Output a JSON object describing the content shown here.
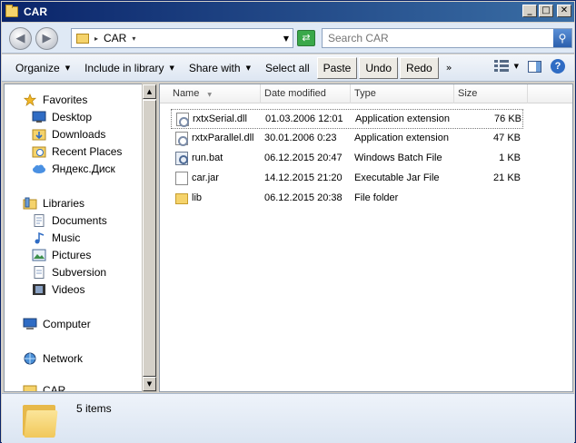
{
  "window": {
    "title": "CAR"
  },
  "address": {
    "path": "CAR",
    "search_placeholder": "Search CAR"
  },
  "toolbar": {
    "organize": "Organize",
    "include_in_library": "Include in library",
    "share_with": "Share with",
    "select_all": "Select all",
    "paste": "Paste",
    "undo": "Undo",
    "redo": "Redo",
    "more": "»"
  },
  "nav": {
    "favorites": "Favorites",
    "desktop": "Desktop",
    "downloads": "Downloads",
    "recent_places": "Recent Places",
    "yandex_disk": "Яндекс.Диск",
    "libraries": "Libraries",
    "documents": "Documents",
    "music": "Music",
    "pictures": "Pictures",
    "subversion": "Subversion",
    "videos": "Videos",
    "computer": "Computer",
    "network": "Network",
    "car": "CAR"
  },
  "columns": {
    "name": "Name",
    "date_modified": "Date modified",
    "type": "Type",
    "size": "Size"
  },
  "files": [
    {
      "name": "rxtxSerial.dll",
      "date": "01.03.2006 12:01",
      "type": "Application extension",
      "size": "76 KB",
      "icon": "dll-icon"
    },
    {
      "name": "rxtxParallel.dll",
      "date": "30.01.2006 0:23",
      "type": "Application extension",
      "size": "47 KB",
      "icon": "dll-icon"
    },
    {
      "name": "run.bat",
      "date": "06.12.2015 20:47",
      "type": "Windows Batch File",
      "size": "1 KB",
      "icon": "batch-file-icon"
    },
    {
      "name": "car.jar",
      "date": "14.12.2015 21:20",
      "type": "Executable Jar File",
      "size": "21 KB",
      "icon": "jar-file-icon"
    },
    {
      "name": "lib",
      "date": "06.12.2015 20:38",
      "type": "File folder",
      "size": "",
      "icon": "folder-icon"
    }
  ],
  "status": {
    "item_count": "5 items"
  }
}
